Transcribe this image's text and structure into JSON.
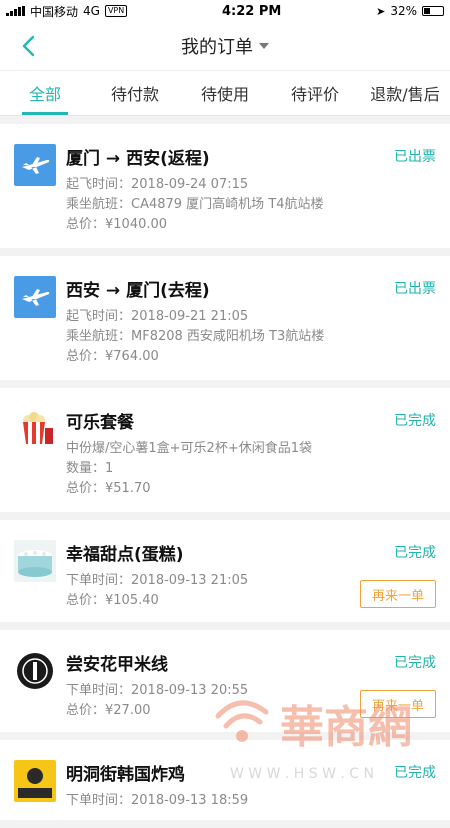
{
  "status_bar": {
    "carrier": "中国移动",
    "network": "4G",
    "vpn": "VPN",
    "time": "4:22 PM",
    "battery": "32%"
  },
  "nav": {
    "title": "我的订单"
  },
  "tabs": [
    "全部",
    "待付款",
    "待使用",
    "待评价",
    "退款/售后"
  ],
  "orders": [
    {
      "title": "厦门 → 西安(返程)",
      "status": "已出票",
      "lines": [
        "起飞时间：2018-09-24 07:15",
        "乘坐航班：CA4879 厦门高崎机场 T4航站楼",
        "总价：¥1040.00"
      ]
    },
    {
      "title": "西安 → 厦门(去程)",
      "status": "已出票",
      "lines": [
        "起飞时间：2018-09-21 21:05",
        "乘坐航班：MF8208 西安咸阳机场 T3航站楼",
        "总价：¥764.00"
      ]
    },
    {
      "title": "可乐套餐",
      "status": "已完成",
      "lines": [
        "中份爆/空心薯1盒+可乐2杯+休闲食品1袋",
        "数量：1",
        "总价：¥51.70"
      ]
    },
    {
      "title": "幸福甜点(蛋糕)",
      "status": "已完成",
      "lines": [
        "下单时间：2018-09-13 21:05",
        "总价：¥105.40"
      ],
      "action": "再来一单"
    },
    {
      "title": "尝安花甲米线",
      "status": "已完成",
      "lines": [
        "下单时间：2018-09-13 20:55",
        "总价：¥27.00"
      ],
      "action": "再来一单"
    },
    {
      "title": "明洞街韩国炸鸡",
      "status": "已完成",
      "lines": [
        "下单时间：2018-09-13 18:59"
      ]
    }
  ],
  "watermark": {
    "text": "華商網",
    "url": "W W W . H S W . C N"
  },
  "colors": {
    "accent": "#22b7b3",
    "action": "#f0a33a",
    "plane": "#4a9be6"
  }
}
